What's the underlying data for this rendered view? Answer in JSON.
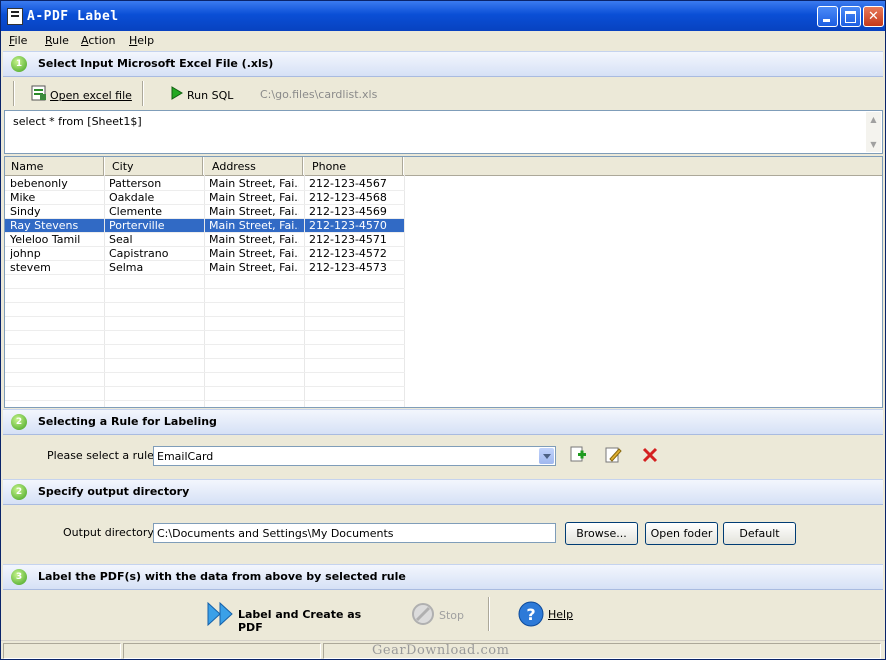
{
  "window": {
    "title": "A-PDF Label"
  },
  "menu": [
    "File",
    "Rule",
    "Action",
    "Help"
  ],
  "section1": {
    "number": "1",
    "label": "Select Input Microsoft Excel File (.xls)"
  },
  "toolbar": {
    "open_label": "Open excel file",
    "run_label": "Run SQL",
    "file_path": "C:\\go.files\\cardlist.xls"
  },
  "sql": {
    "query": "select * from [Sheet1$]"
  },
  "table": {
    "columns": [
      "Name",
      "City",
      "Address",
      "Phone"
    ],
    "rows": [
      [
        "bebenonly",
        "Patterson",
        "Main Street, Fai...",
        "212-123-4567"
      ],
      [
        "Mike",
        "Oakdale",
        "Main Street, Fai...",
        "212-123-4568"
      ],
      [
        "Sindy",
        "Clemente",
        "Main Street, Fai...",
        "212-123-4569"
      ],
      [
        "Ray Stevens",
        "Porterville",
        "Main Street, Fai...",
        "212-123-4570"
      ],
      [
        "Yeleloo Tamil",
        "Seal",
        "Main Street, Fai...",
        "212-123-4571"
      ],
      [
        "johnp",
        "Capistrano",
        "Main Street, Fai...",
        "212-123-4572"
      ],
      [
        "stevem",
        "Selma",
        "Main Street, Fai...",
        "212-123-4573"
      ]
    ],
    "selected_row": 3
  },
  "section2": {
    "number": "2",
    "label": "Selecting a Rule for Labeling"
  },
  "rule": {
    "prompt": "Please select a rule:",
    "selected": "EmailCard"
  },
  "section3": {
    "number": "2",
    "label": "Specify output directory"
  },
  "output": {
    "prompt": "Output directory:",
    "value": "C:\\Documents and Settings\\My Documents",
    "browse": "Browse...",
    "open_folder": "Open foder",
    "default": "Default"
  },
  "section4": {
    "number": "3",
    "label": "Label the PDF(s) with the data from above by selected rule"
  },
  "actions": {
    "create": "Label and Create as PDF",
    "stop": "Stop",
    "help": "Help"
  },
  "watermark": "GearDownload.com",
  "colors": {
    "selection": "#316ac5",
    "title_bar": "#0a4fd6",
    "section_header": "#d6e1f6",
    "delete": "#d42020"
  }
}
